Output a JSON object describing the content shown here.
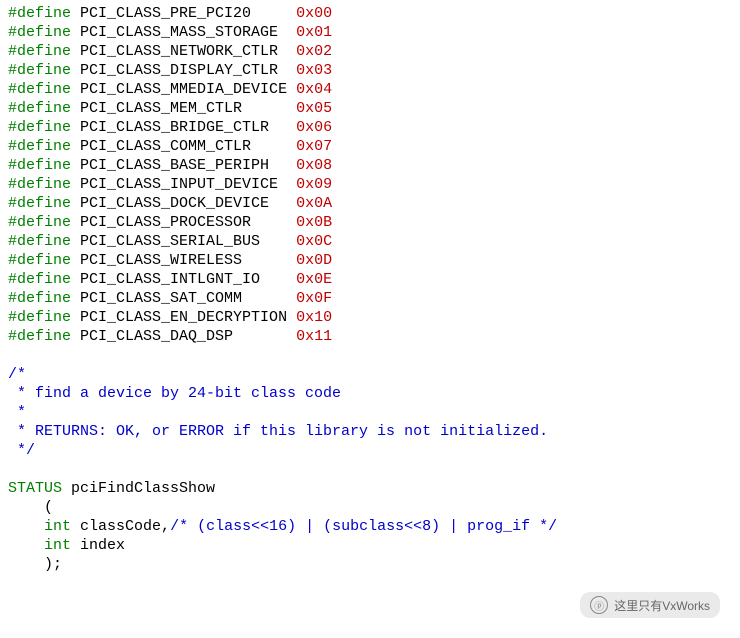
{
  "defines": [
    {
      "name": "PCI_CLASS_PRE_PCI20",
      "value": "0x00"
    },
    {
      "name": "PCI_CLASS_MASS_STORAGE",
      "value": "0x01"
    },
    {
      "name": "PCI_CLASS_NETWORK_CTLR",
      "value": "0x02"
    },
    {
      "name": "PCI_CLASS_DISPLAY_CTLR",
      "value": "0x03"
    },
    {
      "name": "PCI_CLASS_MMEDIA_DEVICE",
      "value": "0x04"
    },
    {
      "name": "PCI_CLASS_MEM_CTLR",
      "value": "0x05"
    },
    {
      "name": "PCI_CLASS_BRIDGE_CTLR",
      "value": "0x06"
    },
    {
      "name": "PCI_CLASS_COMM_CTLR",
      "value": "0x07"
    },
    {
      "name": "PCI_CLASS_BASE_PERIPH",
      "value": "0x08"
    },
    {
      "name": "PCI_CLASS_INPUT_DEVICE",
      "value": "0x09"
    },
    {
      "name": "PCI_CLASS_DOCK_DEVICE",
      "value": "0x0A"
    },
    {
      "name": "PCI_CLASS_PROCESSOR",
      "value": "0x0B"
    },
    {
      "name": "PCI_CLASS_SERIAL_BUS",
      "value": "0x0C"
    },
    {
      "name": "PCI_CLASS_WIRELESS",
      "value": "0x0D"
    },
    {
      "name": "PCI_CLASS_INTLGNT_IO",
      "value": "0x0E"
    },
    {
      "name": "PCI_CLASS_SAT_COMM",
      "value": "0x0F"
    },
    {
      "name": "PCI_CLASS_EN_DECRYPTION",
      "value": "0x10"
    },
    {
      "name": "PCI_CLASS_DAQ_DSP",
      "value": "0x11"
    }
  ],
  "define_keyword": "#define",
  "comment_block": {
    "l1": "/*",
    "l2": " * find a device by 24-bit class code",
    "l3": " *",
    "l4": " * RETURNS: OK, or ERROR if this library is not initialized.",
    "l5": " */"
  },
  "func": {
    "return_type": "STATUS",
    "name": "pciFindClassShow",
    "open_paren": "    (",
    "param1_type": "int",
    "param1_name": "classCode,",
    "param1_comment": "/* (class<<16) | (subclass<<8) | prog_if */",
    "param2_type": "int",
    "param2_name": "index",
    "close_paren": "    );"
  },
  "watermark": {
    "text": "这里只有VxWorks"
  },
  "layout": {
    "name_col_width": 23
  }
}
